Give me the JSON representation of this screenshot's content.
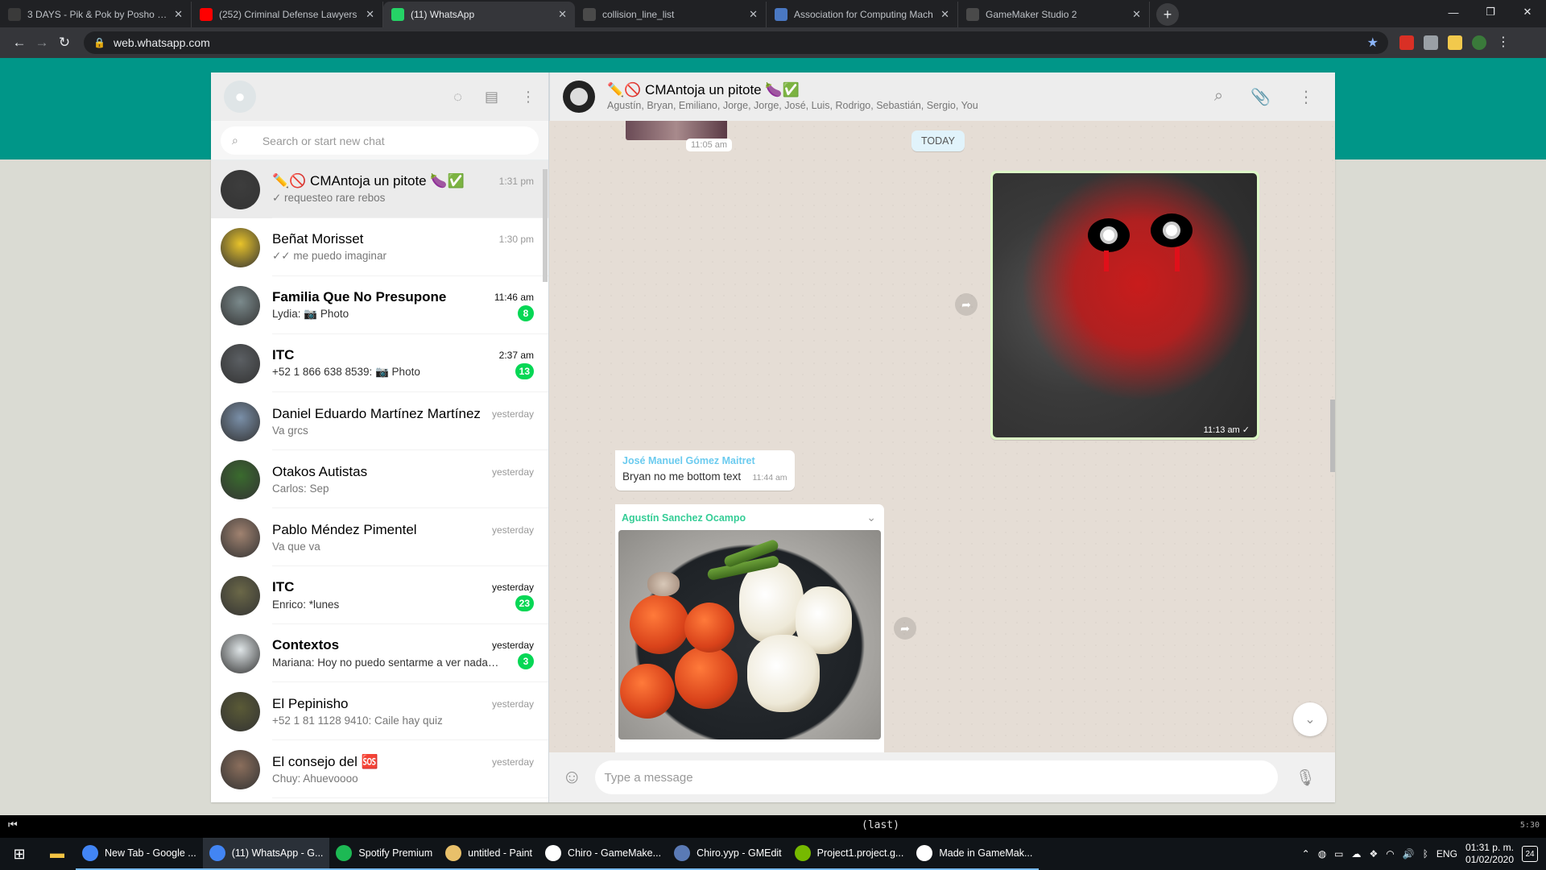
{
  "browser": {
    "tabs": [
      {
        "label": "3 DAYS - Pik & Pok by Posho - G",
        "color": "#3a3a3a",
        "icon": "bolt-icon"
      },
      {
        "label": "(252) Criminal Defense Lawyers",
        "color": "#ff0000",
        "icon": "youtube-icon"
      },
      {
        "label": "(11) WhatsApp",
        "color": "#25d366",
        "icon": "whatsapp-icon"
      },
      {
        "label": "collision_line_list",
        "color": "#4a4a4a",
        "icon": "gamemaker-icon"
      },
      {
        "label": "Association for Computing Mach",
        "color": "#4a78c2",
        "icon": "globe-icon"
      },
      {
        "label": "GameMaker Studio 2",
        "color": "#4a4a4a",
        "icon": "gamemaker-icon"
      }
    ],
    "url": "web.whatsapp.com"
  },
  "sidebar": {
    "search_placeholder": "Search or start new chat",
    "chats": [
      {
        "name": "✏️🚫 CMAntoja un pitote 🍆✅",
        "time": "1:31 pm",
        "preview": "✓ requesteo rare rebos",
        "bold": false,
        "badge": "",
        "color": "#3d3d3d"
      },
      {
        "name": "Beñat Morisset",
        "time": "1:30 pm",
        "preview": "✓✓ me puedo imaginar",
        "bold": false,
        "badge": "",
        "color": "#e8c32a"
      },
      {
        "name": "Familia Que No Presupone",
        "time": "11:46 am",
        "preview": "Lydia: 📷 Photo",
        "bold": true,
        "badge": "8",
        "color": "#7b8a8c"
      },
      {
        "name": "ITC",
        "time": "2:37 am",
        "preview": "+52 1 866 638 8539: 📷 Photo",
        "bold": true,
        "badge": "13",
        "color": "#5b5f63"
      },
      {
        "name": "Daniel Eduardo Martínez Martínez",
        "time": "yesterday",
        "preview": "Va grcs",
        "bold": false,
        "badge": "",
        "color": "#7a8fa8"
      },
      {
        "name": "Otakos Autistas",
        "time": "yesterday",
        "preview": "Carlos: Sep",
        "bold": false,
        "badge": "",
        "color": "#3a6b2e"
      },
      {
        "name": "Pablo Méndez Pimentel",
        "time": "yesterday",
        "preview": "Va que va",
        "bold": false,
        "badge": "",
        "color": "#a08270"
      },
      {
        "name": "ITC",
        "time": "yesterday",
        "preview": "Enrico: *lunes",
        "bold": true,
        "badge": "23",
        "color": "#6b6848"
      },
      {
        "name": "Contextos",
        "time": "yesterday",
        "preview": "Mariana: Hoy no puedo sentarme a ver nada…",
        "bold": true,
        "badge": "3",
        "color": "#dfe5e7"
      },
      {
        "name": "El Pepinisho",
        "time": "yesterday",
        "preview": "+52 1 81 1128 9410: Caile hay quiz",
        "bold": false,
        "badge": "",
        "color": "#5a5a36"
      },
      {
        "name": "El consejo del 🆘",
        "time": "yesterday",
        "preview": "Chuy: Ahuevoooo",
        "bold": false,
        "badge": "",
        "color": "#8a6e5c"
      }
    ]
  },
  "conversation": {
    "title": "✏️🚫 CMAntoja un pitote 🍆✅",
    "members": "Agustín, Bryan, Emiliano, Jorge, Jorge, José, Luis, Rodrigo, Sebastián, Sergio, You",
    "top_time": "11:05 am",
    "date_divider": "TODAY",
    "out_image_time": "11:13 am ✓",
    "text_msg": {
      "sender": "José Manuel Gómez Maitret",
      "text": "Bryan no me bottom text",
      "time": "11:44 am"
    },
    "image_msg": {
      "sender": "Agustín Sanchez Ocampo"
    },
    "compose_placeholder": "Type a message"
  },
  "player": {
    "label": "(last)",
    "counter": "5:30"
  },
  "taskbar": {
    "items": [
      {
        "label": "New Tab - Google ...",
        "color": "#4285f4",
        "state": "open"
      },
      {
        "label": "(11) WhatsApp - G...",
        "color": "#4285f4",
        "state": "active"
      },
      {
        "label": "Spotify Premium",
        "color": "#1db954",
        "state": "open"
      },
      {
        "label": "untitled - Paint",
        "color": "#e8c06a",
        "state": "open"
      },
      {
        "label": "Chiro - GameMake...",
        "color": "#ffffff",
        "state": "open"
      },
      {
        "label": "Chiro.yyp - GMEdit",
        "color": "#5a7ab5",
        "state": "open"
      },
      {
        "label": "Project1.project.g...",
        "color": "#76b900",
        "state": "open"
      },
      {
        "label": "Made in GameMak...",
        "color": "#ffffff",
        "state": "open"
      }
    ],
    "lang": "ENG",
    "time": "01:31 p. m.",
    "date": "01/02/2020",
    "notifications": "24"
  }
}
